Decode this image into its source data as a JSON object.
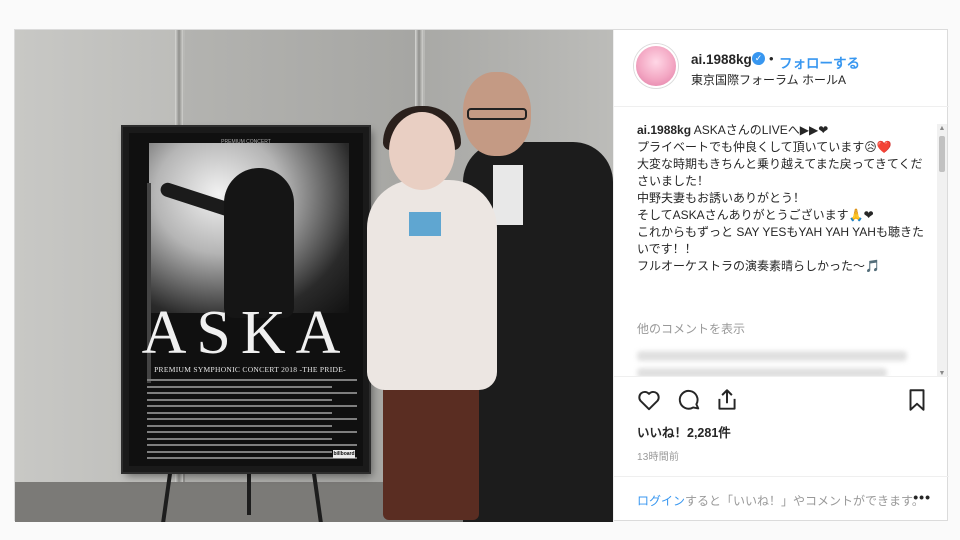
{
  "header": {
    "username": "ai.1988kg",
    "separator": "•",
    "follow_label": "フォローする",
    "location": "東京国際フォーラム ホールA"
  },
  "photo": {
    "poster_small": "PREMIUM CONCERT",
    "poster_title": "ASKA",
    "poster_subtitle": "PREMIUM SYMPHONIC CONCERT 2018 -THE PRIDE-",
    "poster_logo": "billboard"
  },
  "caption": {
    "username": "ai.1988kg",
    "lines": [
      "ASKAさんのLIVEへ▶︎▶︎❤",
      "プライベートでも仲良くして頂いています😥❤️",
      "大変な時期もきちんと乗り越えてまた戻ってきてくださいました！",
      "中野夫妻もお誘いありがとう！",
      "そしてASKAさんありがとうございます🙏❤",
      "これからもずっと SAY YESもYAH YAH YAHも聴きたいです！！",
      "フルオーケストラの演奏素晴らしかった〜🎵"
    ]
  },
  "comments": {
    "more_label": "他のコメントを表示"
  },
  "actions": {
    "like_icon": "heart-icon",
    "comment_icon": "comment-icon",
    "share_icon": "share-icon",
    "save_icon": "bookmark-icon"
  },
  "likes": {
    "label": "いいね！2,281件"
  },
  "time": {
    "label": "13時間前"
  },
  "login": {
    "link_label": "ログイン",
    "text": "すると「いいね！」やコメントができます。",
    "more_label": "•••"
  },
  "colors": {
    "accent": "#3897f0",
    "border": "#dbdbdb",
    "text": "#262626",
    "muted": "#999999"
  }
}
